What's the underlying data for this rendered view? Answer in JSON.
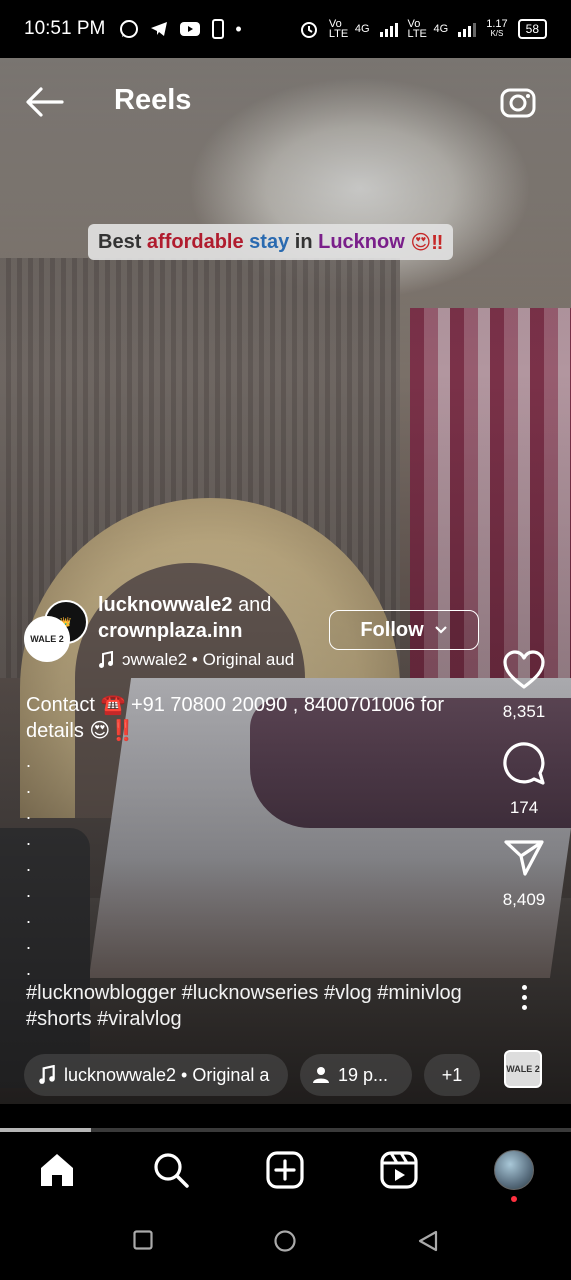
{
  "status_bar": {
    "time": "10:51 PM",
    "app_icons": [
      "whatsapp-icon",
      "telegram-icon",
      "youtube-icon",
      "phone-icon"
    ],
    "dot": "•",
    "sim1": "Vo LTE",
    "net1": "4G",
    "sim2": "Vo LTE",
    "net2": "4G",
    "speed_value": "1.17",
    "speed_unit": "K/S",
    "battery": "58"
  },
  "header": {
    "title": "Reels",
    "back_icon": "arrow-left-icon",
    "camera_icon": "camera-icon"
  },
  "video": {
    "banner_words": [
      "Best",
      "affordable",
      "stay",
      "in",
      "Lucknow"
    ],
    "banner_emoji": "😍‼"
  },
  "post": {
    "author1": "lucknowwale2",
    "and_text": "and",
    "author2": "crownplaza.inn",
    "avatar_front_label": "WALE 2",
    "avatar_back_label": "👑",
    "follow_label": "Follow",
    "music_text": "ɔwwale2 • Original aud",
    "description": "Contact ☎️ +91 70800 20090 , 8400701006 for details 😍‼️",
    "dots": [
      ".",
      ".",
      ".",
      ".",
      ".",
      ".",
      ".",
      ".",
      ".",
      "."
    ],
    "hashtags": "#lucknowblogger #lucknowseries #vlog #minivlog #shorts #viralvlog"
  },
  "actions": {
    "likes": "8,351",
    "comments": "174",
    "shares": "8,409"
  },
  "bottom_pills": {
    "audio": "lucknowwale2 • Original a",
    "people": "19 p...",
    "more": "+1",
    "thumb_label": "WALE 2"
  },
  "playback": {
    "progress": 0.16
  },
  "nav": {
    "items": [
      "home-icon",
      "search-icon",
      "create-icon",
      "reels-icon",
      "profile-avatar"
    ]
  },
  "colors": {
    "banner_red": "#b01c2e",
    "banner_blue": "#2a6ab0",
    "banner_purple": "#7a1f8a",
    "notification_dot": "#ff3040"
  }
}
